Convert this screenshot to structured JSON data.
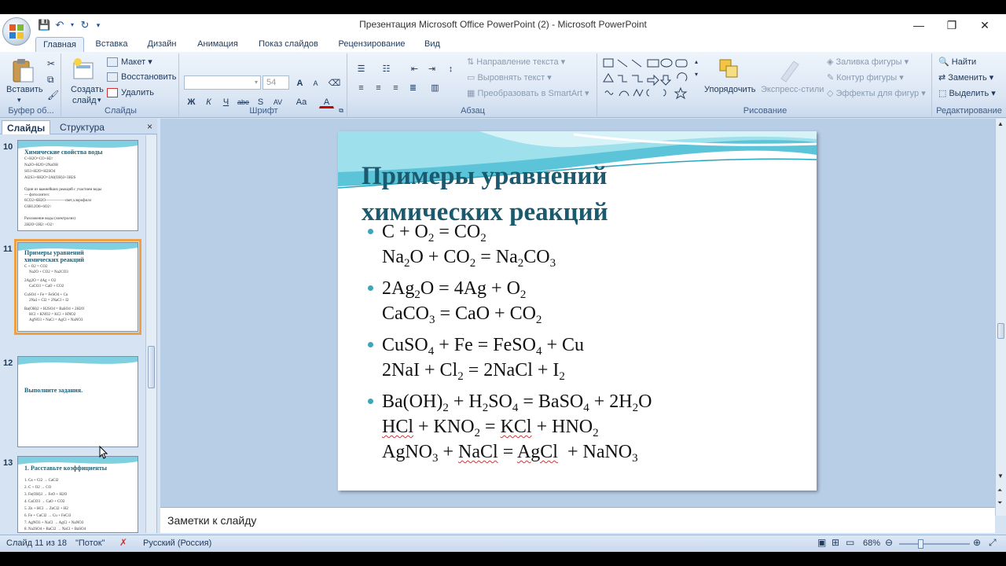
{
  "window": {
    "title": "Презентация Microsoft Office PowerPoint (2) - Microsoft PowerPoint",
    "minimize": "—",
    "restore": "❐",
    "close": "✕"
  },
  "tabs": [
    "Главная",
    "Вставка",
    "Дизайн",
    "Анимация",
    "Показ слайдов",
    "Рецензирование",
    "Вид"
  ],
  "ribbon": {
    "clipboard": {
      "paste": "Вставить",
      "label": "Буфер об..."
    },
    "slides": {
      "create": "Создать",
      "create2": "слайд",
      "layout": "Макет",
      "reset": "Восстановить",
      "delete": "Удалить",
      "label": "Слайды"
    },
    "font": {
      "size": "54",
      "label": "Шрифт",
      "bold": "Ж",
      "italic": "К",
      "underline": "Ч",
      "strike": "abe",
      "shadow": "S",
      "spacing": "AV",
      "case": "Aa",
      "color": "A",
      "grow": "A",
      "shrink": "A"
    },
    "paragraph": {
      "direction": "Направление текста",
      "align": "Выровнять текст",
      "smartart": "Преобразовать в SmartArt",
      "label": "Абзац"
    },
    "drawing": {
      "arrange": "Упорядочить",
      "styles": "Экспресс-стили",
      "fill": "Заливка фигуры",
      "outline": "Контур фигуры",
      "effects": "Эффекты для фигур",
      "label": "Рисование"
    },
    "editing": {
      "find": "Найти",
      "replace": "Заменить",
      "select": "Выделить",
      "label": "Редактирование"
    }
  },
  "panel": {
    "tab_slides": "Слайды",
    "tab_outline": "Структура",
    "close": "×"
  },
  "thumbs": [
    {
      "num": "10",
      "title": "Химические свойства воды",
      "lines": [
        "C+H2O=CO+H2↑",
        "Na2O+H2O=2NaOH",
        "SO3+H2O=H2SO4",
        "Al2S3+6H2O=2Al(OH)3+3H2S",
        "",
        "Один из важнейших реакций с участием воды",
        "— фотосинтез:",
        "6CO2+6H2O—————свет,хлорофилл",
        "C6H12O6+6O2↑",
        "",
        "Разложение воды (электролиз)",
        "2H2O=2H2↑+O2↑"
      ]
    },
    {
      "num": "11",
      "title": "Примеры уравнений химических реакций",
      "lines": [
        "C + O2 = CO2",
        "Na2O + CO2 = Na2CO3",
        "2Ag2O = 4Ag + O2",
        "CaCO3 = CaO + CO2",
        "CuSO4 + Fe = FeSO4 + Cu",
        "2NaI + Cl2 = 2NaCl + I2",
        "Ba(OH)2 + H2SO4 = BaSO4 + 2H2O",
        "HCl + KNO2 = KCl + HNO2",
        "AgNO3 + NaCl = AgCl + NaNO3"
      ]
    },
    {
      "num": "12",
      "title": "Выполните задания.",
      "lines": []
    },
    {
      "num": "13",
      "title": "1. Расставьте коэффициенты",
      "lines": [
        "1. Ca + Cl2 → CaCl2",
        "2. C + O2 → CO",
        "3. Fe(OH)3 → FeO + H2O",
        "4. CaCO3 → CaO + CO2",
        "5. Zn + HCl → ZnCl2 + H2",
        "6. Fe + CuCl2 → Cu + FeCl3",
        "7. AgNO3 + NaCl → AgCl + NaNO3",
        "8. Na2SO4 + BaCl2 → NaCl + BaSO4"
      ]
    }
  ],
  "slide": {
    "title_line1": "Примеры уравнений",
    "title_line2": "химических реакций"
  },
  "notes": {
    "placeholder": "Заметки к слайду"
  },
  "status": {
    "slide": "Слайд 11 из 18",
    "theme": "\"Поток\"",
    "lang": "Русский (Россия)",
    "zoom": "68%"
  },
  "colors": {
    "accent": "#1b5a6e",
    "bullet": "#3aa6b9",
    "ribbon": "#dbe6f4",
    "selection": "#f0a040"
  }
}
